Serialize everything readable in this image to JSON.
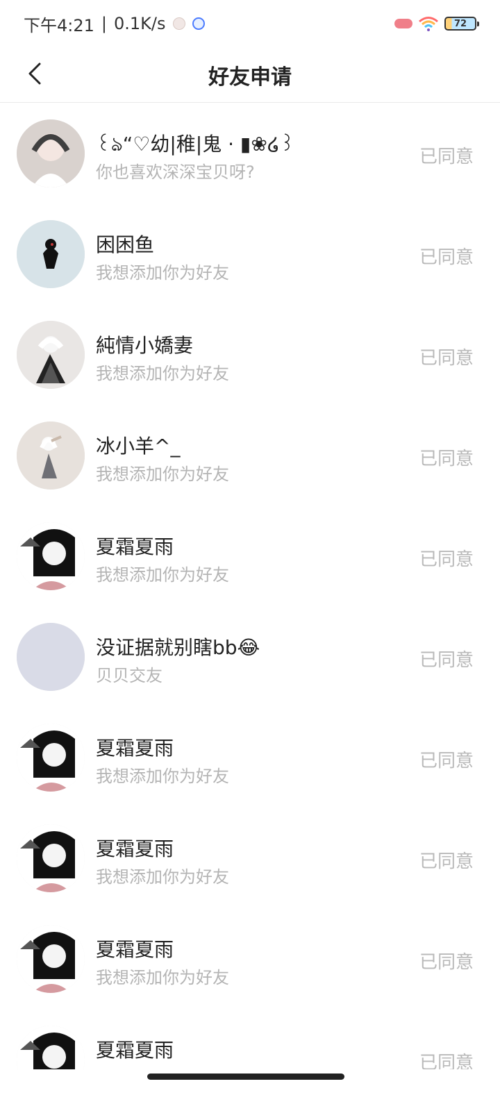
{
  "status_bar": {
    "time": "下午4:21",
    "network_speed": "0.1K/s",
    "battery": "72"
  },
  "header": {
    "title": "好友申请"
  },
  "requests": [
    {
      "name": "꒰ঌ“♡幼|稚|鬼 · ▮❀໒꒱",
      "message": "你也喜欢深深宝贝呀?",
      "status": "已同意",
      "avatar_color": "#d9d2ce"
    },
    {
      "name": "困困鱼",
      "message": "我想添加你为好友",
      "status": "已同意",
      "avatar_color": "#d7e3e8"
    },
    {
      "name": "純情小嬌妻",
      "message": "我想添加你为好友",
      "status": "已同意",
      "avatar_color": "#e9e6e4"
    },
    {
      "name": "冰小羊^_",
      "message": "我想添加你为好友",
      "status": "已同意",
      "avatar_color": "#e7e1dc"
    },
    {
      "name": "夏霜夏雨",
      "message": "我想添加你为好友",
      "status": "已同意",
      "avatar_color": "#d59a9f"
    },
    {
      "name": "没证据就别瞎bb😂",
      "message": "贝贝交友",
      "status": "已同意",
      "avatar_color": "#d9dbe7"
    },
    {
      "name": "夏霜夏雨",
      "message": "我想添加你为好友",
      "status": "已同意",
      "avatar_color": "#d59a9f"
    },
    {
      "name": "夏霜夏雨",
      "message": "我想添加你为好友",
      "status": "已同意",
      "avatar_color": "#d59a9f"
    },
    {
      "name": "夏霜夏雨",
      "message": "我想添加你为好友",
      "status": "已同意",
      "avatar_color": "#d59a9f"
    },
    {
      "name": "夏霜夏雨",
      "message": "",
      "status": "已同意",
      "avatar_color": "#d59a9f"
    }
  ]
}
